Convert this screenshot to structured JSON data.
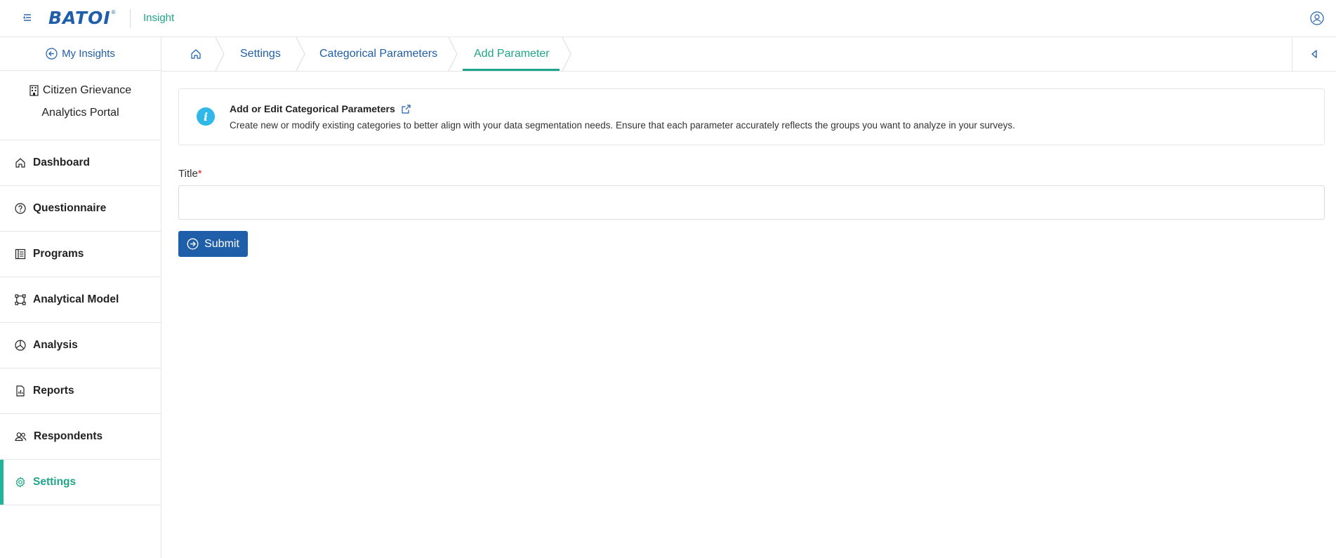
{
  "topbar": {
    "logo_text": "BATOI",
    "logo_mark": "®",
    "app_name": "Insight",
    "menu_icon": "menu-icon",
    "user_icon": "user-icon"
  },
  "sidebar": {
    "back_label": "My Insights",
    "org_line1": "Citizen Grievance",
    "org_line2": "Analytics Portal",
    "items": [
      {
        "label": "Dashboard",
        "icon": "home-icon"
      },
      {
        "label": "Questionnaire",
        "icon": "question-icon"
      },
      {
        "label": "Programs",
        "icon": "list-icon"
      },
      {
        "label": "Analytical Model",
        "icon": "model-icon"
      },
      {
        "label": "Analysis",
        "icon": "pie-chart-icon"
      },
      {
        "label": "Reports",
        "icon": "report-icon"
      },
      {
        "label": "Respondents",
        "icon": "users-icon"
      },
      {
        "label": "Settings",
        "icon": "gear-icon",
        "active": true
      }
    ]
  },
  "breadcrumb": {
    "home_icon": "home-icon",
    "items": [
      "Settings",
      "Categorical Parameters",
      "Add Parameter"
    ],
    "active_index": 2
  },
  "info": {
    "title": "Add or Edit Categorical Parameters",
    "description": "Create new or modify existing categories to better align with your data segmentation needs. Ensure that each parameter accurately reflects the groups you want to analyze in your surveys."
  },
  "form": {
    "title_label": "Title",
    "required_mark": "*",
    "title_value": "",
    "submit_label": "Submit"
  },
  "colors": {
    "primary": "#1f5ea8",
    "accent": "#1fa58a",
    "info": "#2fb8e8",
    "required": "#e02424"
  }
}
